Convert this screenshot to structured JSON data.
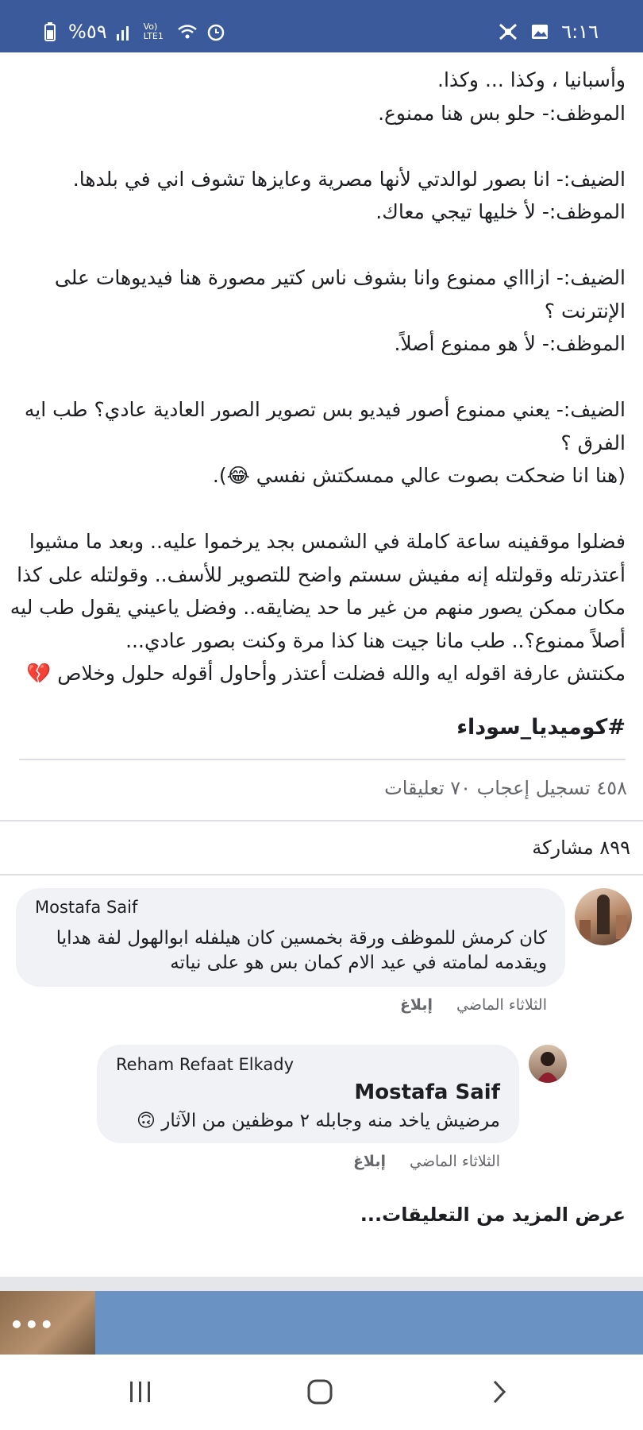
{
  "status_bar": {
    "time": "٦:١٦",
    "battery": "%٥٩",
    "network": "Vo) LTE1"
  },
  "post": {
    "lines": [
      "وأسبانيا ، وكذا ... وكذا.",
      "الموظف:- حلو بس هنا ممنوع.",
      "",
      "الضيف:- انا بصور لوالدتي لأنها مصرية وعايزها تشوف اني في بلدها.",
      "الموظف:- لأ خليها تيجي معاك.",
      "",
      "الضيف:- ازاااي ممنوع وانا بشوف ناس كتير مصورة هنا فيديوهات على",
      "الإنترنت ؟",
      "الموظف:- لأ هو ممنوع أصلاً.",
      "",
      "الضيف:- يعني ممنوع أصور فيديو بس تصوير الصور العادية عادي؟ طب ايه",
      "الفرق ؟",
      "(هنا انا ضحكت بصوت عالي ممسكتش نفسي 😂).",
      "",
      "فضلوا موقفينه ساعة كاملة في الشمس بجد يرخموا عليه.. وبعد ما مشيوا",
      "أعتذرتله وقولتله إنه مفيش سستم واضح للتصوير للأسف.. وقولتله على كذا",
      "مكان ممكن يصور منهم من غير ما حد يضايقه.. وفضل ياعيني يقول طب ليه",
      "أصلاً ممنوع؟.. طب مانا جيت هنا كذا مرة وكنت بصور عادي...",
      "مكنتش عارفة اقوله ايه والله فضلت أعتذر وأحاول أقوله حلول وخلاص 💔"
    ],
    "hashtag": "#كوميديا_سوداء",
    "reactions": "٤٥٨ تسجيل إعجاب ٧٠ تعليقات",
    "shares": "٨٩٩ مشاركة"
  },
  "comments": [
    {
      "author": "Mostafa Saif",
      "text_line1": "كان كرمش للموظف ورقة بخمسين كان هيلفله ابوالهول لفة هدايا",
      "text_line2": "ويقدمه لمامته في عيد الام كمان بس هو على نياته",
      "time": "الثلاثاء الماضي",
      "report": "إبلاغ"
    }
  ],
  "reply": {
    "author": "Reham Refaat Elkady",
    "mention": "Mostafa Saif",
    "text": "مرضيش ياخد منه وجابله ٢ موظفين من الآثار 🙃",
    "time": "الثلاثاء الماضي",
    "report": "إبلاغ"
  },
  "more_comments": "عرض المزيد من التعليقات...",
  "next_post": {
    "menu_label": "•••"
  },
  "colors": {
    "header": "#3b5a9b",
    "bubble": "#f0f2f5",
    "muted": "#65676b"
  }
}
